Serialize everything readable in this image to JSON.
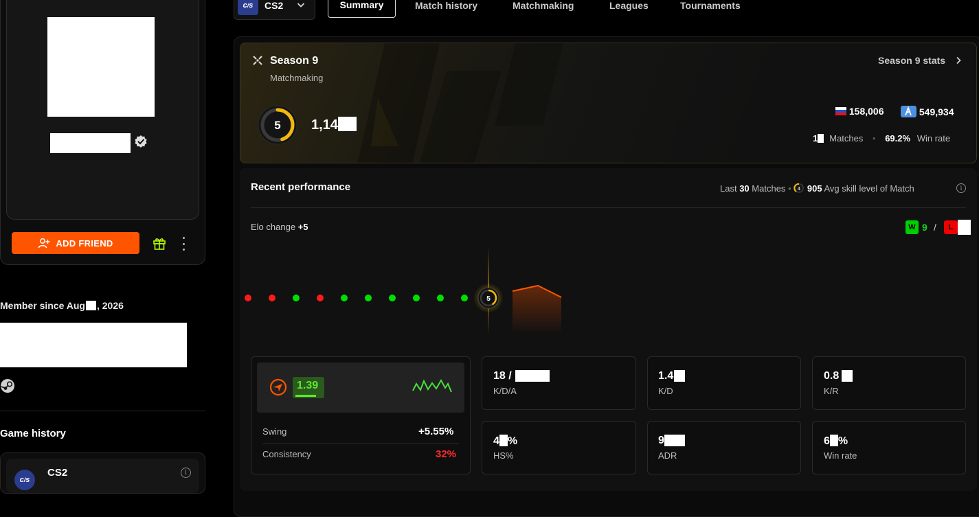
{
  "sidebar": {
    "add_friend_label": "ADD FRIEND",
    "member_since": "Member since Aug",
    "member_year": ", 2026",
    "game_history_title": "Game history",
    "game_history_items": [
      {
        "name": "CS2",
        "logo": "cs2-logo"
      }
    ]
  },
  "nav": {
    "game_logo": "cs2-logo",
    "game_name": "CS2",
    "tabs": [
      {
        "label": "Summary",
        "active": true
      },
      {
        "label": "Match history"
      },
      {
        "label": "Matchmaking"
      },
      {
        "label": "Leagues"
      },
      {
        "label": "Tournaments"
      }
    ]
  },
  "season": {
    "title": "Season 9",
    "subtitle": "Matchmaking",
    "stats_link": "Season 9 stats",
    "level": "5",
    "level_fraction": 0.45,
    "elo_partial": "1,14",
    "country_rank": "158,006",
    "region_rank": "549,934",
    "matches_partial": "1",
    "matches_label": "Matches",
    "win_rate": "69.2%",
    "win_rate_label": "Win rate",
    "accent": "#f2b90c"
  },
  "performance": {
    "title": "Recent performance",
    "last_label": "Last",
    "last_count": "30",
    "last_suffix": "Matches",
    "avg_skill": "905",
    "avg_skill_label": "Avg skill level of Match",
    "elo_change_label": "Elo change",
    "elo_change_value": "+5",
    "wins_badge": "W",
    "wins": "9",
    "losses_badge": "L",
    "separator": "/",
    "current_level": "5",
    "results": [
      "L",
      "L",
      "W",
      "L",
      "W",
      "W",
      "W",
      "W",
      "W",
      "W"
    ],
    "colors": {
      "win": "#00e000",
      "loss": "#ff1a1a",
      "accent": "#ff5500"
    }
  },
  "rating": {
    "value": "1.39",
    "swing_label": "Swing",
    "swing_value": "+5.55%",
    "consistency_label": "Consistency",
    "consistency_value": "32%"
  },
  "stats": [
    {
      "value": "18 /",
      "label": "K/D/A"
    },
    {
      "value": "1.4",
      "label": "K/D"
    },
    {
      "value": "0.8",
      "label": "K/R"
    },
    {
      "value": "4",
      "value_suffix": "%",
      "label": "HS%"
    },
    {
      "value": "9",
      "label": "ADR"
    },
    {
      "value": "6",
      "value_suffix": "%",
      "label": "Win rate"
    }
  ]
}
